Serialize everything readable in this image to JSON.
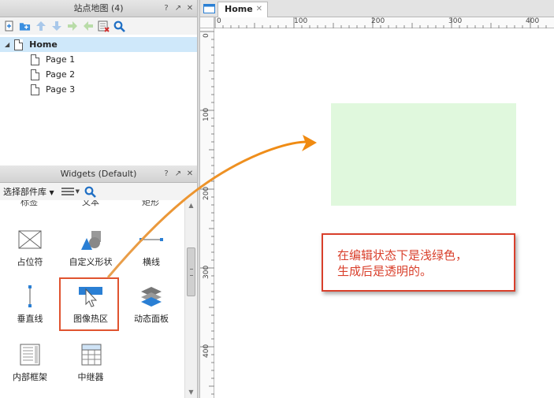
{
  "sitemap": {
    "title": "站点地图 (4)",
    "help": "?",
    "float": "↗",
    "close": "✕",
    "tree": {
      "root": "Home",
      "pages": [
        "Page 1",
        "Page 2",
        "Page 3"
      ]
    }
  },
  "widgets": {
    "title": "Widgets (Default)",
    "help": "?",
    "float": "↗",
    "close": "✕",
    "library_select": "选择部件库",
    "cut_labels": [
      "标签",
      "文本",
      "矩形"
    ],
    "items": [
      {
        "label": "占位符",
        "icon": "placeholder-icon"
      },
      {
        "label": "自定义形状",
        "icon": "custom-shape-icon"
      },
      {
        "label": "横线",
        "icon": "horizontal-line-icon"
      },
      {
        "label": "垂直线",
        "icon": "vertical-line-icon"
      },
      {
        "label": "图像热区",
        "icon": "image-hotspot-icon"
      },
      {
        "label": "动态面板",
        "icon": "dynamic-panel-icon"
      },
      {
        "label": "内部框架",
        "icon": "inline-frame-icon"
      },
      {
        "label": "中继器",
        "icon": "repeater-icon"
      }
    ]
  },
  "canvas": {
    "tab": "Home",
    "tab_close": "✕",
    "ruler_top": [
      "0",
      "100",
      "200",
      "300",
      "400"
    ],
    "ruler_left": [
      "0",
      "100",
      "200",
      "300",
      "400"
    ],
    "callout": "在编辑状态下是浅绿色，\n生成后是透明的。"
  },
  "colors": {
    "hotspot_fill": "#e0f8dd",
    "callout_border": "#d9402c",
    "arrow": "#f0a030",
    "selection": "#cfe8fa"
  }
}
